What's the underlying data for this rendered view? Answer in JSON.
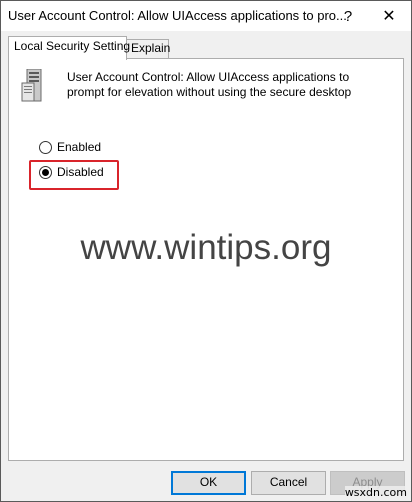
{
  "window": {
    "title": "User Account Control: Allow UIAccess applications to pro...",
    "help_glyph": "?",
    "close_glyph": "✕"
  },
  "tabs": [
    {
      "label": "Local Security Setting",
      "active": true
    },
    {
      "label": "Explain",
      "active": false
    }
  ],
  "policy": {
    "icon": "server-policy-icon",
    "description": "User Account Control: Allow UIAccess applications to prompt for elevation without using the secure desktop"
  },
  "options": {
    "enabled_label": "Enabled",
    "disabled_label": "Disabled",
    "selected": "Disabled"
  },
  "highlight_color": "#d9242b",
  "watermark": "www.wintips.org",
  "buttons": {
    "ok": "OK",
    "cancel": "Cancel",
    "apply": "Apply"
  },
  "corner_watermark": "wsxdn.com"
}
